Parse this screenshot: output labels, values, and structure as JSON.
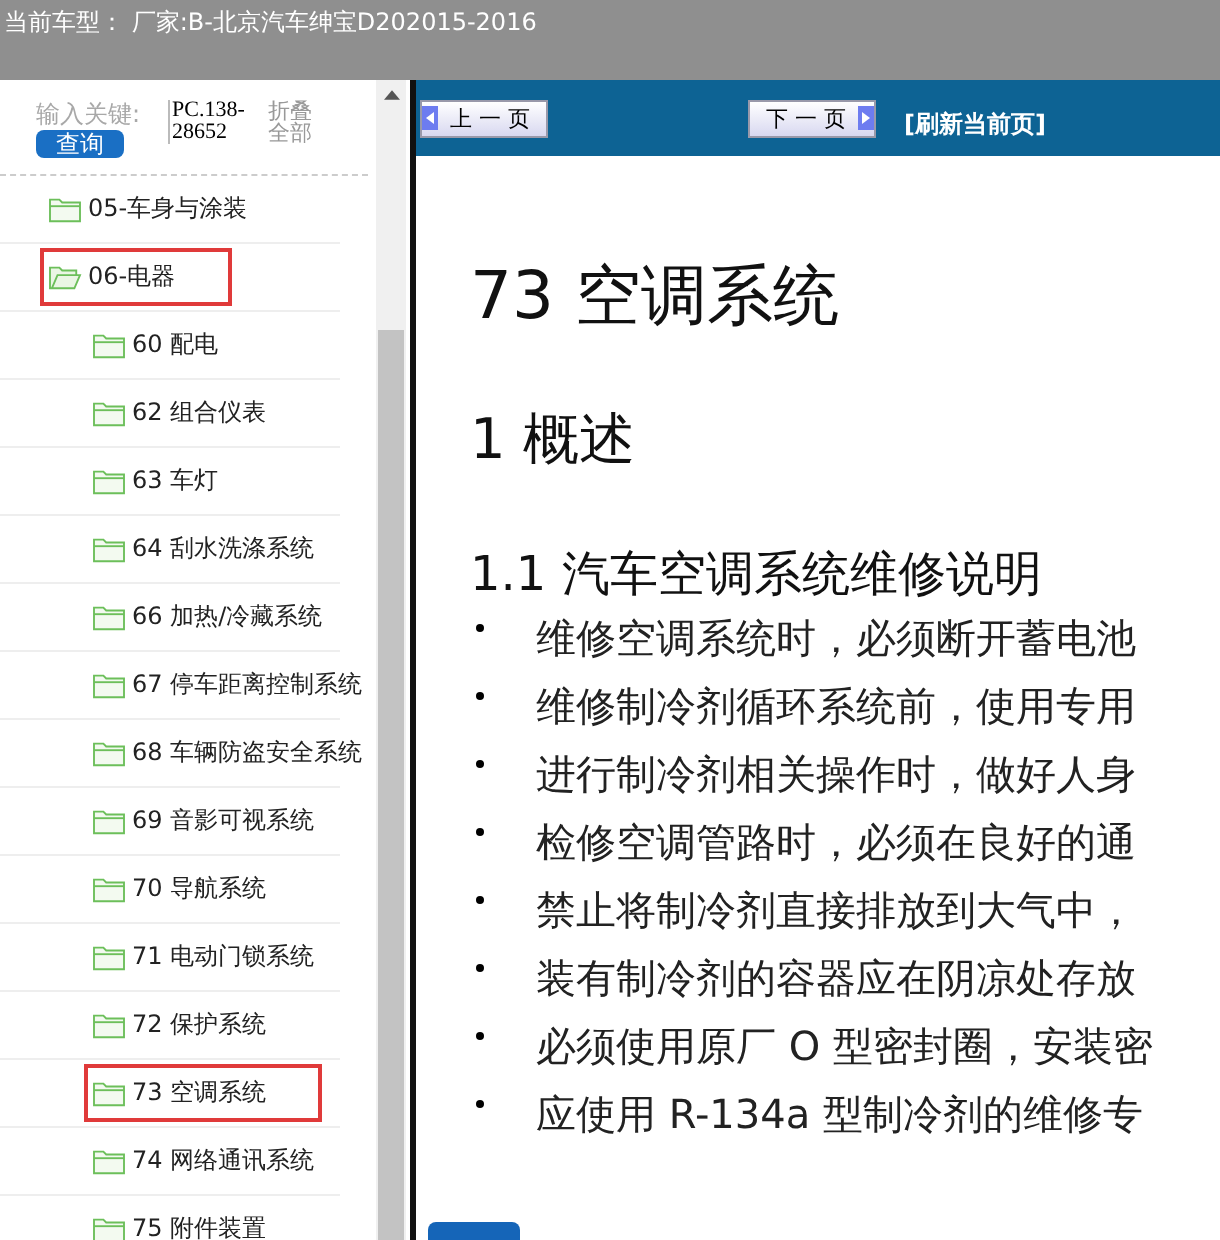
{
  "header": {
    "title": "当前车型： 厂家:B-北京汽车绅宝D202015-2016"
  },
  "search": {
    "label": "输入关键:",
    "button": "查询",
    "value": "PC.138-28652",
    "collapse_link": "折叠全部"
  },
  "tree": [
    {
      "label": "05-车身与涂装",
      "expanded": false,
      "highlighted": false
    },
    {
      "label": "06-电器",
      "expanded": true,
      "highlighted": true,
      "children": [
        {
          "label": "60 配电",
          "expanded": false,
          "highlighted": false
        },
        {
          "label": "62 组合仪表",
          "expanded": false,
          "highlighted": false
        },
        {
          "label": "63 车灯",
          "expanded": false,
          "highlighted": false
        },
        {
          "label": "64 刮水洗涤系统",
          "expanded": false,
          "highlighted": false
        },
        {
          "label": "66 加热/冷藏系统",
          "expanded": false,
          "highlighted": false
        },
        {
          "label": "67 停车距离控制系统",
          "expanded": false,
          "highlighted": false
        },
        {
          "label": "68 车辆防盗安全系统",
          "expanded": false,
          "highlighted": false
        },
        {
          "label": "69 音影可视系统",
          "expanded": false,
          "highlighted": false
        },
        {
          "label": "70 导航系统",
          "expanded": false,
          "highlighted": false
        },
        {
          "label": "71 电动门锁系统",
          "expanded": false,
          "highlighted": false
        },
        {
          "label": "72 保护系统",
          "expanded": false,
          "highlighted": false
        },
        {
          "label": "73 空调系统",
          "expanded": false,
          "highlighted": true
        },
        {
          "label": "74 网络通讯系统",
          "expanded": false,
          "highlighted": false
        },
        {
          "label": "75 附件装置",
          "expanded": false,
          "highlighted": false
        }
      ]
    }
  ],
  "toolbar": {
    "prev": "上 一 页",
    "next": "下 一 页",
    "refresh": "[刷新当前页]"
  },
  "document": {
    "title": "73 空调系统",
    "heading": "1 概述",
    "subheading": "1.1 汽车空调系统维修说明",
    "bullets": [
      "维修空调系统时，必须断开蓄电池",
      "维修制冷剂循环系统前，使用专用",
      "进行制冷剂相关操作时，做好人身",
      "检修空调管路时，必须在良好的通",
      "禁止将制冷剂直接排放到大气中，",
      "装有制冷剂的容器应在阴凉处存放",
      "必须使用原厂 O 型密封圈，安装密",
      "应使用 R-134a 型制冷剂的维修专"
    ]
  }
}
